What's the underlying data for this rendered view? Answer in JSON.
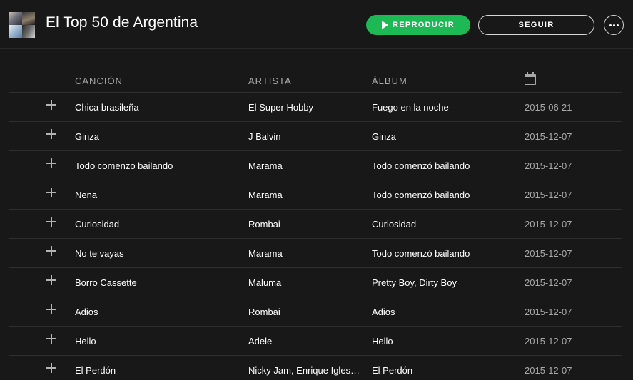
{
  "playlist": {
    "title": "El Top 50 de Argentina",
    "play_label": "REPRODUCIR",
    "follow_label": "SEGUIR",
    "accent_color": "#1db954"
  },
  "table": {
    "headers": {
      "song": "CANCIÓN",
      "artist": "ARTISTA",
      "album": "ÁLBUM",
      "date_icon": "calendar-icon"
    },
    "rows": [
      {
        "song": "Chica brasileña",
        "artist": "El Super Hobby",
        "album": "Fuego en la noche",
        "date": "2015-06-21"
      },
      {
        "song": "Ginza",
        "artist": "J Balvin",
        "album": "Ginza",
        "date": "2015-12-07"
      },
      {
        "song": "Todo comenzo bailando",
        "artist": "Marama",
        "album": "Todo comenzó bailando",
        "date": "2015-12-07"
      },
      {
        "song": "Nena",
        "artist": "Marama",
        "album": "Todo comenzó bailando",
        "date": "2015-12-07"
      },
      {
        "song": "Curiosidad",
        "artist": "Rombai",
        "album": "Curiosidad",
        "date": "2015-12-07"
      },
      {
        "song": "No te vayas",
        "artist": "Marama",
        "album": "Todo comenzó bailando",
        "date": "2015-12-07"
      },
      {
        "song": "Borro Cassette",
        "artist": "Maluma",
        "album": "Pretty Boy, Dirty Boy",
        "date": "2015-12-07"
      },
      {
        "song": "Adios",
        "artist": "Rombai",
        "album": "Adios",
        "date": "2015-12-07"
      },
      {
        "song": "Hello",
        "artist": "Adele",
        "album": "Hello",
        "date": "2015-12-07"
      },
      {
        "song": "El Perdón",
        "artist": "Nicky Jam, Enrique Igles…",
        "album": "El Perdón",
        "date": "2015-12-07"
      }
    ]
  }
}
